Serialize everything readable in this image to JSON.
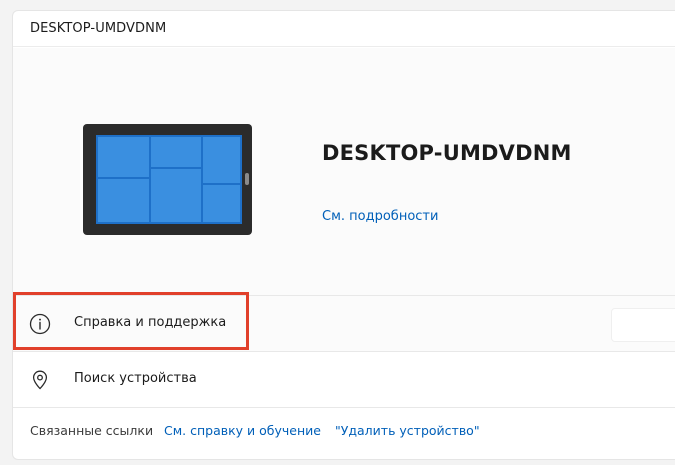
{
  "header": {
    "title": "DESKTOP-UMDVDNM"
  },
  "device": {
    "name": "DESKTOP-UMDVDNM",
    "details_link": "См. подробности",
    "image_icon": "tablet-device-icon"
  },
  "rows": [
    {
      "label": "Справка и поддержка",
      "icon": "info-icon",
      "highlighted": true
    },
    {
      "label": "Поиск устройства",
      "icon": "location-pin-icon"
    }
  ],
  "related": {
    "label": "Связанные ссылки",
    "links": [
      "См. справку и обучение",
      "\"Удалить устройство\""
    ]
  },
  "colors": {
    "link": "#005fb8",
    "highlight_border": "#e1402b",
    "tablet_screen": "#1e70c8",
    "tablet_tile": "#3a8fe0",
    "tablet_frame": "#2b2b2b"
  }
}
